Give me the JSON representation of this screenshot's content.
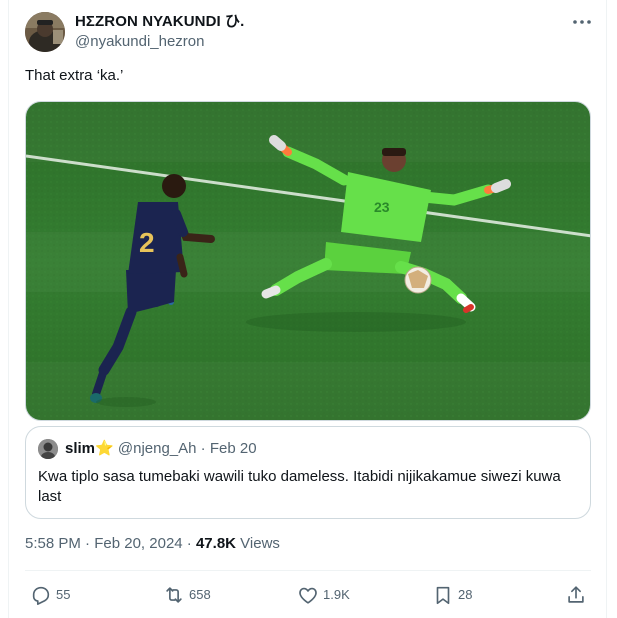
{
  "tweet": {
    "author": {
      "display_name": "HΣZRON NYAKUNDI ひ.",
      "handle": "@nyakundi_hezron"
    },
    "more_icon": "more-horizontal-icon",
    "text": "That extra ‘ka.’",
    "media": {
      "kind": "photo",
      "shirt_numbers": [
        "2",
        "23"
      ],
      "colors": {
        "pitch": "#2f7a2d",
        "keeper_kit": "#66e04a",
        "outfield_kit": "#1b2450"
      }
    },
    "quoted": {
      "name": "slim⭐",
      "handle": "@njeng_Ah",
      "separator": "·",
      "date": "Feb 20",
      "text": "Kwa tiplo sasa tumebaki wawili tuko dameless. Itabidi nijikakamue siwezi kuwa last"
    },
    "meta": {
      "time": "5:58 PM",
      "separator": "·",
      "date": "Feb 20, 2024",
      "separator2": "·",
      "views_count": "47.8K",
      "views_label": "Views"
    },
    "actions": {
      "replies": {
        "icon": "reply-icon",
        "count": "55"
      },
      "reposts": {
        "icon": "repost-icon",
        "count": "658"
      },
      "likes": {
        "icon": "heart-icon",
        "count": "1.9K"
      },
      "bookmarks": {
        "icon": "bookmark-icon",
        "count": "28"
      },
      "share": {
        "icon": "share-icon"
      }
    },
    "colors": {
      "text_primary": "#0f1419",
      "text_secondary": "#536471",
      "border": "#cfd9de"
    }
  }
}
